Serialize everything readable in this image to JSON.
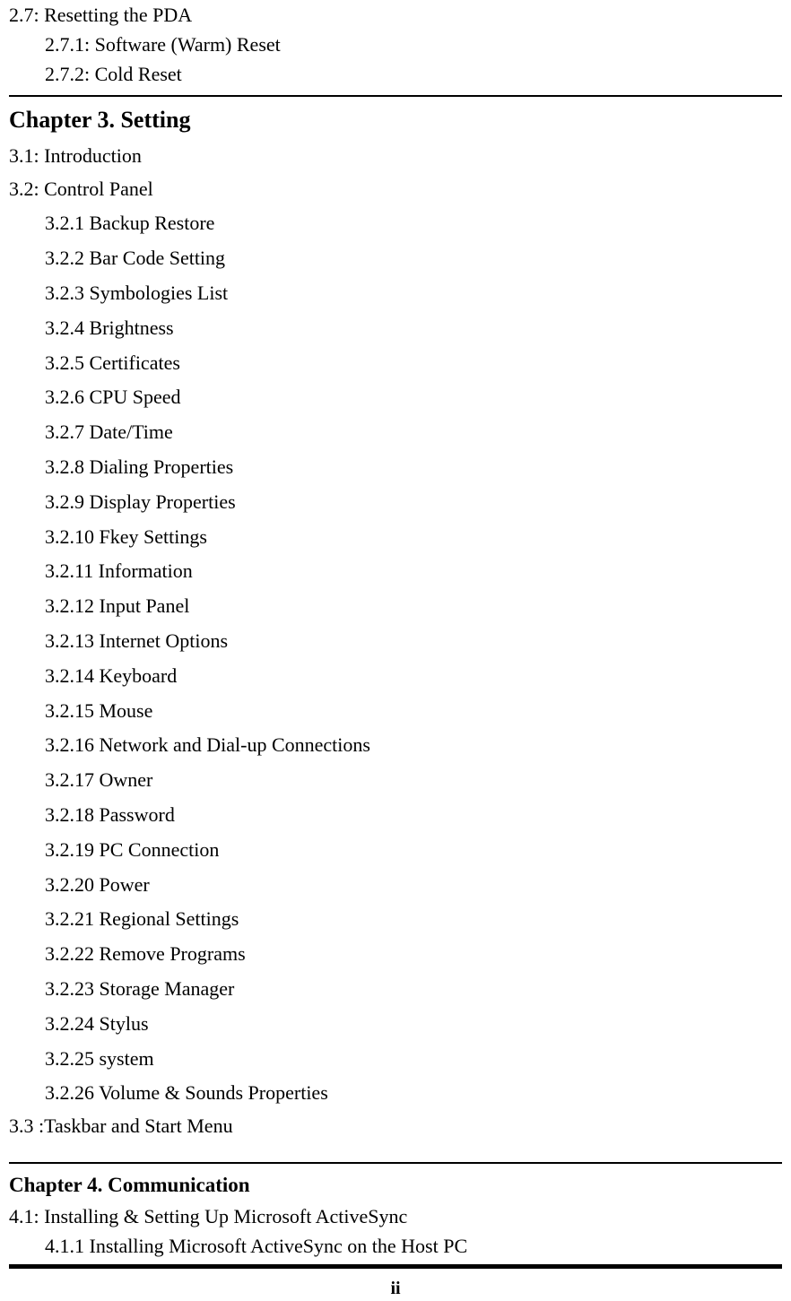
{
  "section27": {
    "title": "2.7: Resetting the PDA",
    "items": [
      "2.7.1: Software (Warm) Reset",
      "2.7.2: Cold Reset"
    ]
  },
  "chapter3": {
    "heading": "Chapter 3. Setting",
    "section31": "3.1: Introduction",
    "section32": {
      "title": "3.2: Control Panel",
      "items": [
        "3.2.1 Backup Restore",
        "3.2.2 Bar Code Setting",
        "3.2.3 Symbologies List",
        "3.2.4 Brightness",
        "3.2.5 Certificates",
        "3.2.6 CPU Speed",
        "3.2.7 Date/Time",
        "3.2.8 Dialing Properties",
        "3.2.9 Display Properties",
        "3.2.10 Fkey Settings",
        "3.2.11 Information",
        "3.2.12 Input Panel",
        "3.2.13 Internet Options",
        "3.2.14 Keyboard",
        "3.2.15 Mouse",
        "3.2.16 Network and Dial-up Connections",
        "3.2.17 Owner",
        "3.2.18 Password",
        "3.2.19 PC Connection",
        "3.2.20 Power",
        "3.2.21 Regional Settings",
        "3.2.22 Remove Programs",
        "3.2.23 Storage Manager",
        "3.2.24 Stylus",
        "3.2.25 system",
        "3.2.26 Volume & Sounds Properties"
      ]
    },
    "section33": "3.3 :Taskbar and Start Menu"
  },
  "chapter4": {
    "heading": "Chapter 4. Communication",
    "section41": {
      "title": "4.1: Installing & Setting Up Microsoft ActiveSync",
      "items": [
        "4.1.1 Installing Microsoft ActiveSync on the Host PC"
      ]
    }
  },
  "pageNumber": "ii"
}
